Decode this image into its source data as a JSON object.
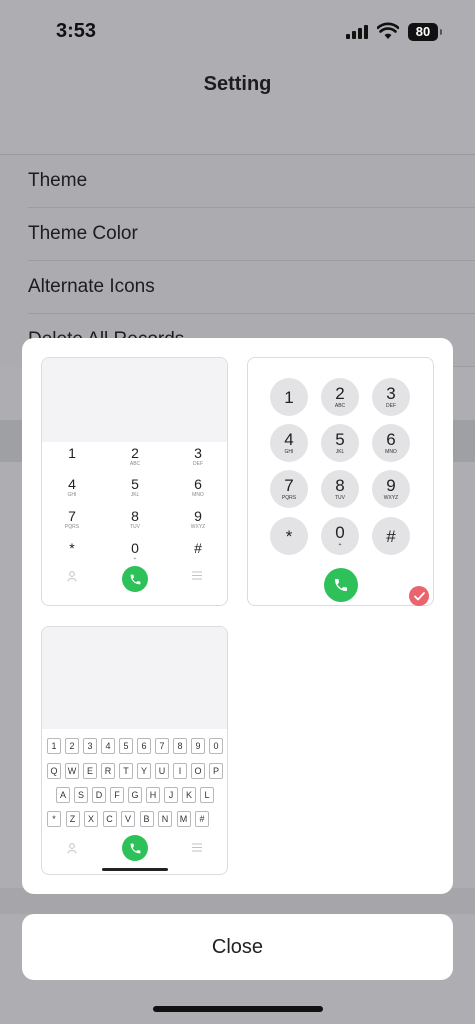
{
  "status_bar": {
    "time": "3:53",
    "battery": "80"
  },
  "background": {
    "title": "Setting",
    "items": [
      "Theme",
      "Theme Color",
      "Alternate Icons",
      "Delete All Records"
    ]
  },
  "keypad_option_1": {
    "keys": [
      {
        "n": "1",
        "l": ""
      },
      {
        "n": "2",
        "l": "ABC"
      },
      {
        "n": "3",
        "l": "DEF"
      },
      {
        "n": "4",
        "l": "GHI"
      },
      {
        "n": "5",
        "l": "JKL"
      },
      {
        "n": "6",
        "l": "MNO"
      },
      {
        "n": "7",
        "l": "PQRS"
      },
      {
        "n": "8",
        "l": "TUV"
      },
      {
        "n": "9",
        "l": "WXYZ"
      },
      {
        "n": "*",
        "l": ""
      },
      {
        "n": "0",
        "l": "+"
      },
      {
        "n": "#",
        "l": ""
      }
    ]
  },
  "keypad_option_2": {
    "keys": [
      {
        "n": "1",
        "l": ""
      },
      {
        "n": "2",
        "l": "ABC"
      },
      {
        "n": "3",
        "l": "DEF"
      },
      {
        "n": "4",
        "l": "GHI"
      },
      {
        "n": "5",
        "l": "JKL"
      },
      {
        "n": "6",
        "l": "MNO"
      },
      {
        "n": "7",
        "l": "PQRS"
      },
      {
        "n": "8",
        "l": "TUV"
      },
      {
        "n": "9",
        "l": "WXYZ"
      },
      {
        "n": "*",
        "l": ""
      },
      {
        "n": "0",
        "l": "+"
      },
      {
        "n": "#",
        "l": ""
      }
    ],
    "selected": true
  },
  "keypad_option_3": {
    "rows": [
      [
        "1",
        "2",
        "3",
        "4",
        "5",
        "6",
        "7",
        "8",
        "9",
        "0"
      ],
      [
        "Q",
        "W",
        "E",
        "R",
        "T",
        "Y",
        "U",
        "I",
        "O",
        "P"
      ],
      [
        "A",
        "S",
        "D",
        "F",
        "G",
        "H",
        "J",
        "K",
        "L"
      ],
      [
        "*",
        "Z",
        "X",
        "C",
        "V",
        "B",
        "N",
        "M",
        "#"
      ]
    ]
  },
  "close_button": {
    "label": "Close"
  },
  "colors": {
    "call_green": "#2ec15a",
    "check_red": "#e9646d"
  }
}
